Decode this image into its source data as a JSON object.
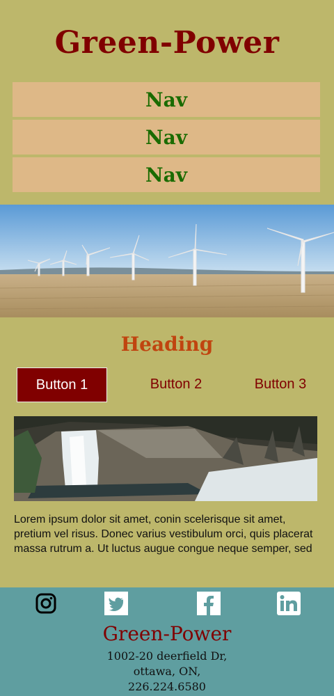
{
  "site": {
    "title": "Green-Power"
  },
  "nav": {
    "items": [
      {
        "label": "Nav"
      },
      {
        "label": "Nav"
      },
      {
        "label": "Nav"
      }
    ]
  },
  "hero": {
    "alt": "wind turbines in a field",
    "icon": "wind-turbines-image"
  },
  "main": {
    "heading": "Heading",
    "buttons": [
      {
        "label": "Button 1",
        "active": true
      },
      {
        "label": "Button 2"
      },
      {
        "label": "Button 3"
      }
    ],
    "paragraph": "Lorem ipsum dolor sit amet, conin scelerisque sit amet, pretium vel risus. Donec varius vestibulum orci, quis placerat massa rutrum a. Ut luctus augue congue neque semper, sed"
  },
  "footer": {
    "social": [
      "instagram-icon",
      "twitter-icon",
      "facebook-icon",
      "linkedin-icon"
    ],
    "title": "Green-Power",
    "address": [
      "1002-20 deerfield Dr,",
      "ottawa, ON,",
      "226.224.6580"
    ]
  },
  "colors": {
    "background": "#bdb76b",
    "nav": "#deb887",
    "brand": "#800000",
    "heading": "#c0440f",
    "footer": "#5f9ea0"
  }
}
